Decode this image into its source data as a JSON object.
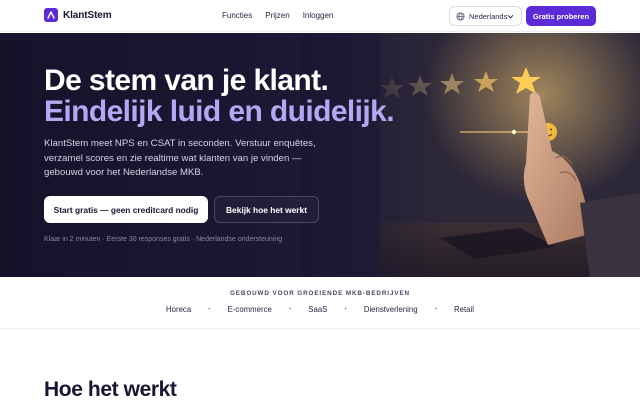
{
  "brand": {
    "name": "KlantStem",
    "accent": "#5b2bd8",
    "logo_icon": "sound-wave-icon"
  },
  "nav": {
    "items": [
      "Functies",
      "Prijzen",
      "Inloggen"
    ]
  },
  "language": {
    "selected": "Nederlands",
    "icon": "globe-icon"
  },
  "header_cta": "Gratis proberen",
  "hero": {
    "title_line1": "De stem van je klant.",
    "title_line2": "Eindelijk luid en duidelijk.",
    "lead": "KlantStem meet NPS en CSAT in seconden. Verstuur enquêtes, verzamel scores en zie realtime wat klanten van je vinden — gebouwd voor het Nederlandse MKB.",
    "primary_cta": "Start gratis — geen creditcard nodig",
    "secondary_cta": "Bekijk hoe het werkt",
    "note": "Klaar in 2 minuten · Eerste 30 responses gratis · Nederlandse ondersteuning",
    "image": "hand-touching-five-star-rating-with-smiley",
    "highlight_color": "#b7a6f4"
  },
  "trust": {
    "title": "GEBOUWD VOOR GROEIENDE MKB-BEDRIJVEN",
    "sectors": [
      "Horeca",
      "E-commerce",
      "SaaS",
      "Dienstverlening",
      "Retail"
    ]
  },
  "how_it_works": {
    "title": "Hoe het werkt"
  }
}
